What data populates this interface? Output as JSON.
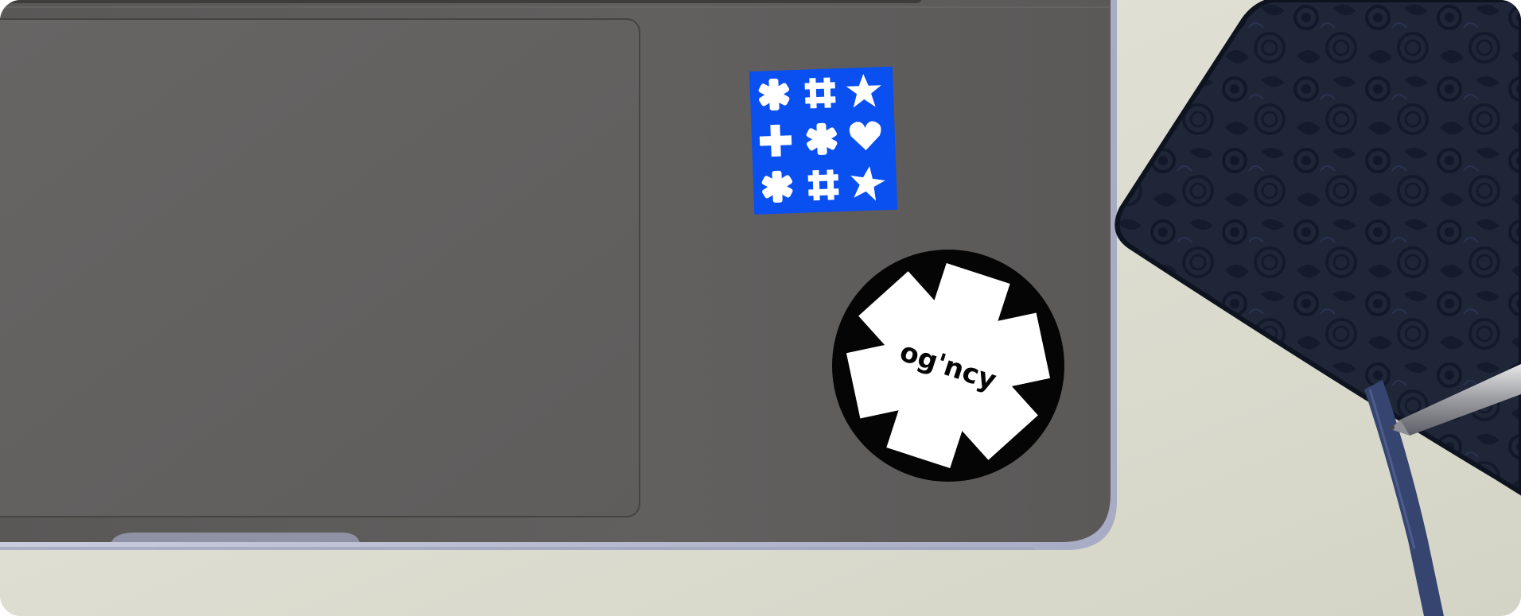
{
  "scene": {
    "description_free": true,
    "colors": {
      "desk": "#dcdcd0",
      "laptop_body": "#5f5d5c",
      "laptop_edge": "#4e4c4b",
      "trackpad": "#646261",
      "case_clear": "#b9bcd0",
      "sticker_blue": "#0a4ff0",
      "sticker_black": "#050505",
      "sticker_white": "#ffffff",
      "notebook": "#1d2537",
      "ribbon": "#36456f"
    }
  },
  "stickers": {
    "brand_sticker": {
      "logo_text": "og'ncy",
      "icon": "asterisk-logo"
    },
    "pattern_sticker": {
      "icons": [
        "asterisk",
        "hash",
        "star",
        "plus",
        "asterisk",
        "heart",
        "asterisk",
        "hash",
        "star"
      ]
    }
  }
}
